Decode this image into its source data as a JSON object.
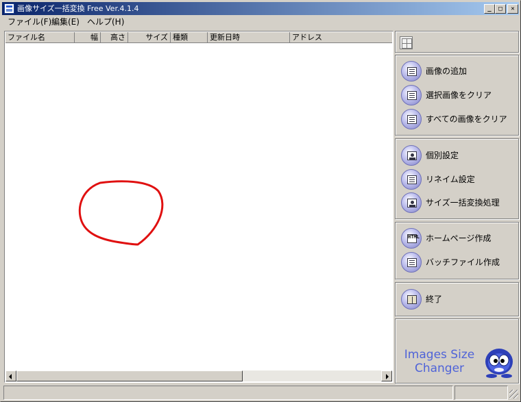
{
  "window": {
    "title": "画像サイズ一括変換 Free Ver.4.1.4",
    "minimize": "_",
    "maximize": "□",
    "close": "✕"
  },
  "menu": {
    "file": "ファイル(F)",
    "edit": "編集(E)",
    "help": "ヘルプ(H)"
  },
  "list": {
    "columns": {
      "filename": "ファイル名",
      "width": "幅",
      "height": "高さ",
      "size": "サイズ",
      "type": "種類",
      "modified": "更新日時",
      "address": "アドレス"
    },
    "rows": []
  },
  "panel": {
    "add_image": "画像の追加",
    "clear_selected": "選択画像をクリア",
    "clear_all": "すべての画像をクリア",
    "individual_settings": "個別設定",
    "rename_settings": "リネイム設定",
    "batch_resize": "サイズ一括変換処理",
    "homepage_create": "ホームページ作成",
    "batch_file_create": "バッチファイル作成",
    "exit": "終了",
    "html_glyph": "HTML",
    "logo_line1": "Images Size",
    "logo_line2": "Changer"
  },
  "icons": {
    "app": "app-icon",
    "view_toggle": "grid-view-icon",
    "add": "add-image-icon",
    "clear_selected": "clear-selected-icon",
    "clear_all": "clear-all-icon",
    "individual": "person-icon",
    "rename": "rename-icon",
    "batch": "batch-convert-icon",
    "homepage": "html-icon",
    "batchfile": "batch-file-icon",
    "exit": "exit-door-icon"
  },
  "colors": {
    "title_gradient_start": "#0a246a",
    "title_gradient_end": "#a6caf0",
    "logo_blue": "#4f63d8",
    "annotation_red": "#e01010"
  }
}
